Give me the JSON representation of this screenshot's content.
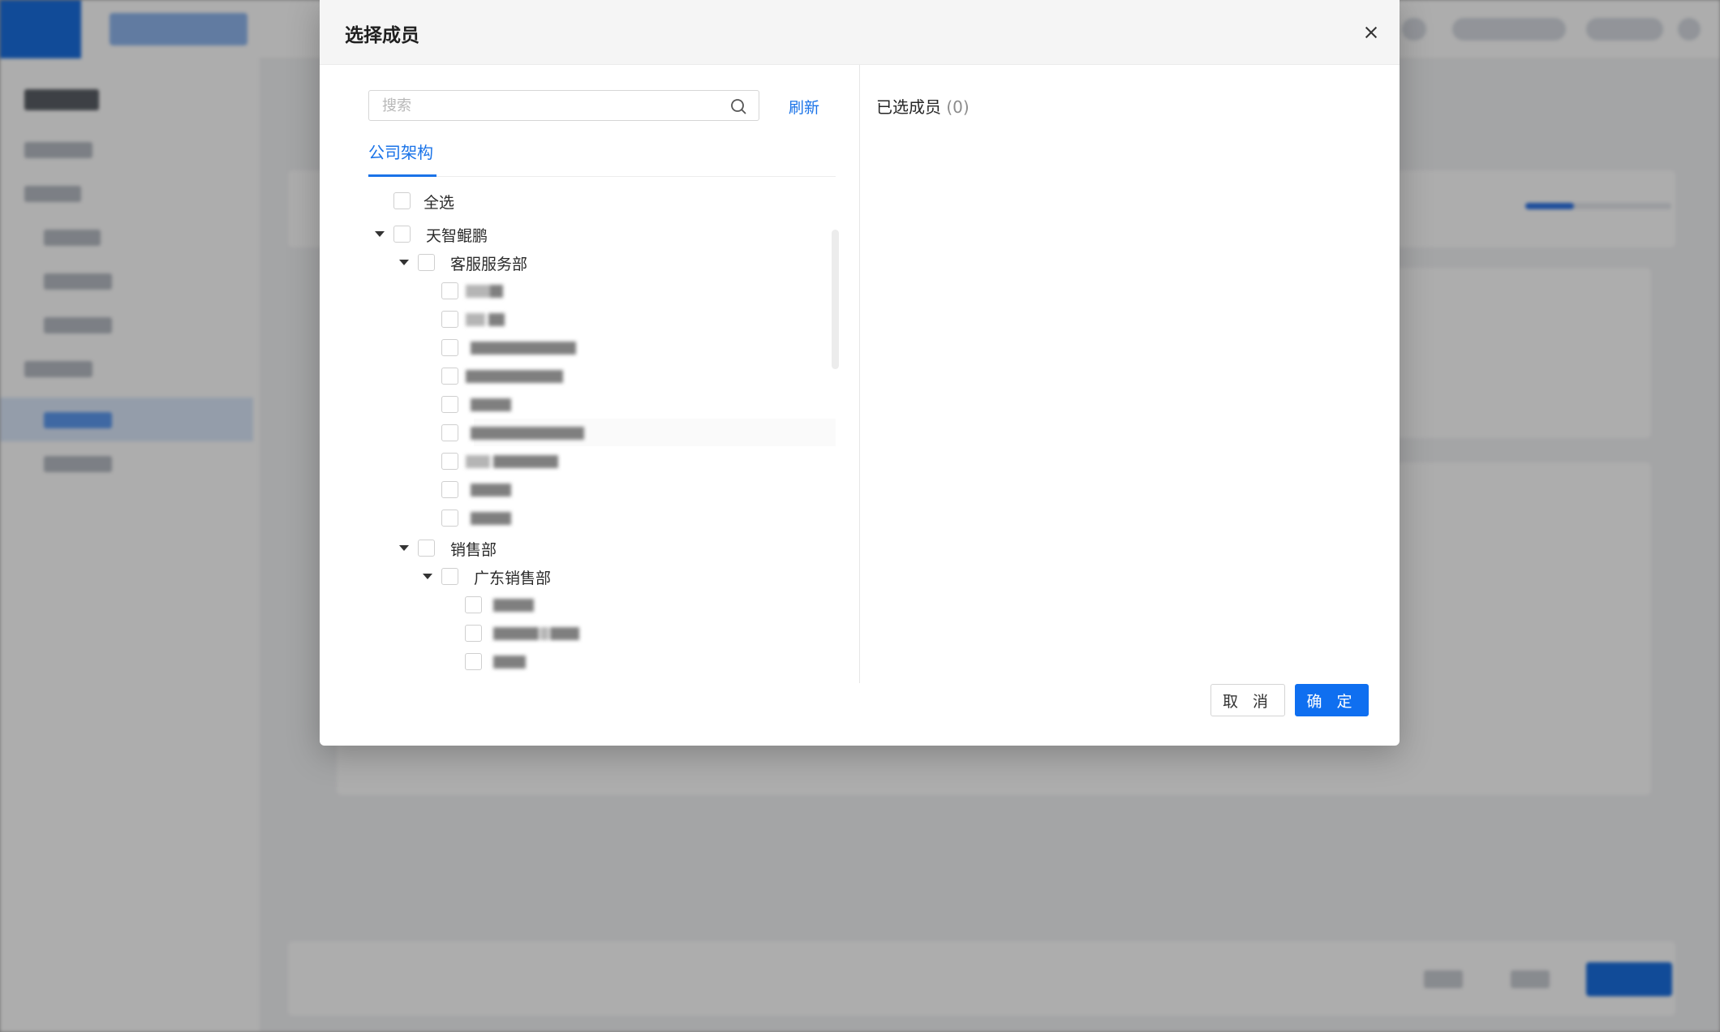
{
  "modal": {
    "title": "选择成员",
    "close_icon": "close-icon",
    "search": {
      "placeholder": "搜索",
      "value": "",
      "icon": "search-icon"
    },
    "refresh_label": "刷新",
    "tabs": [
      {
        "label": "公司架构",
        "active": true
      }
    ],
    "tree": {
      "select_all_label": "全选",
      "root": "天智鲲鹏",
      "dept_service": "客服服务部",
      "dept_sales": "销售部",
      "dept_guangdong": "广东销售部"
    },
    "selected": {
      "title": "已选成员",
      "count": "(0)"
    },
    "buttons": {
      "cancel": "取 消",
      "ok": "确 定"
    }
  },
  "colors": {
    "accent": "#1a73e8",
    "primary_button": "#0f6ff0",
    "header_bg": "#f5f5f5"
  }
}
